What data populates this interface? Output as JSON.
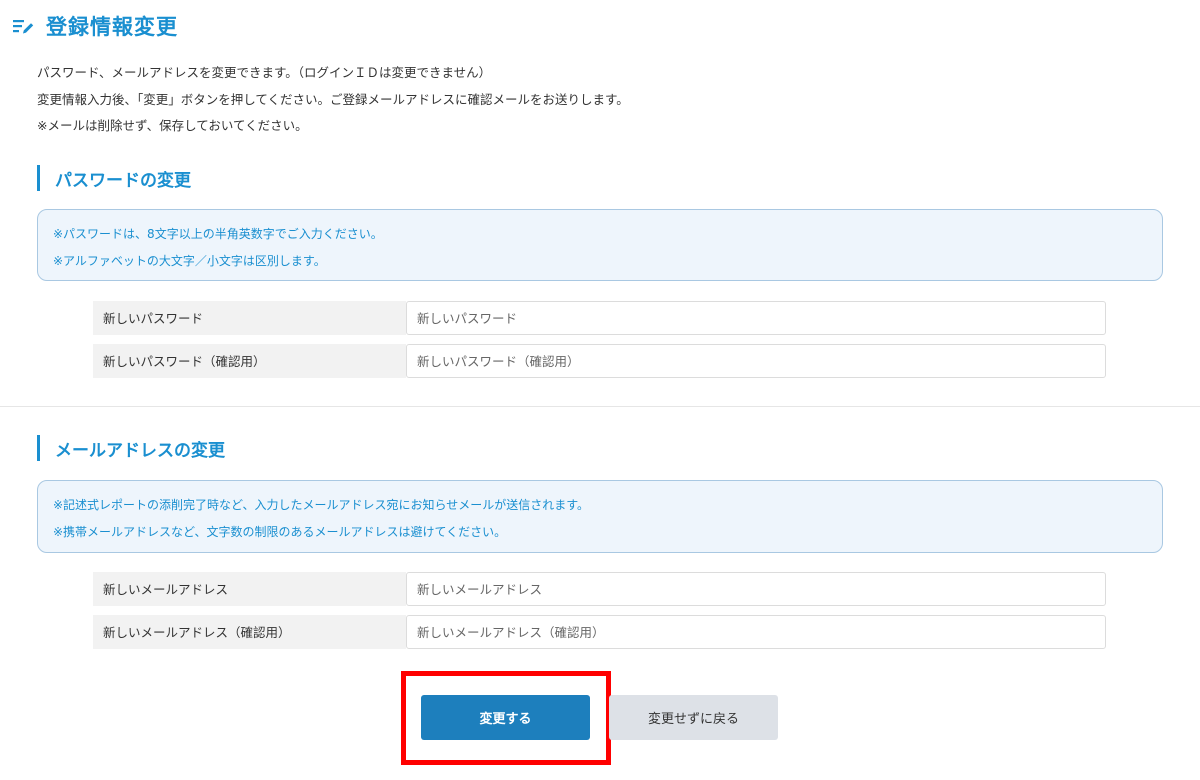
{
  "page": {
    "title": "登録情報変更",
    "header_icon": "edit-list-icon",
    "accent_color": "#1a8fd0",
    "primary_button_color": "#1d7fbd"
  },
  "intro": {
    "line1": "パスワード、メールアドレスを変更できます。（ログインＩＤは変更できません）",
    "line2": "変更情報入力後、「変更」ボタンを押してください。ご登録メールアドレスに確認メールをお送りします。",
    "line3": "※メールは削除せず、保存しておいてください。"
  },
  "password_section": {
    "title": "パスワードの変更",
    "notes": [
      "※パスワードは、8文字以上の半角英数字でご入力ください。",
      "※アルファベットの大文字／小文字は区別します。"
    ],
    "fields": [
      {
        "label": "新しいパスワード",
        "placeholder": "新しいパスワード",
        "value": ""
      },
      {
        "label": "新しいパスワード（確認用）",
        "placeholder": "新しいパスワード（確認用）",
        "value": ""
      }
    ]
  },
  "email_section": {
    "title": "メールアドレスの変更",
    "notes": [
      "※記述式レポートの添削完了時など、入力したメールアドレス宛にお知らせメールが送信されます。",
      "※携帯メールアドレスなど、文字数の制限のあるメールアドレスは避けてください。"
    ],
    "fields": [
      {
        "label": "新しいメールアドレス",
        "placeholder": "新しいメールアドレス",
        "value": ""
      },
      {
        "label": "新しいメールアドレス（確認用）",
        "placeholder": "新しいメールアドレス（確認用）",
        "value": ""
      }
    ]
  },
  "actions": {
    "submit_label": "変更する",
    "back_label": "変更せずに戻る",
    "highlight_color": "#ff0000"
  }
}
